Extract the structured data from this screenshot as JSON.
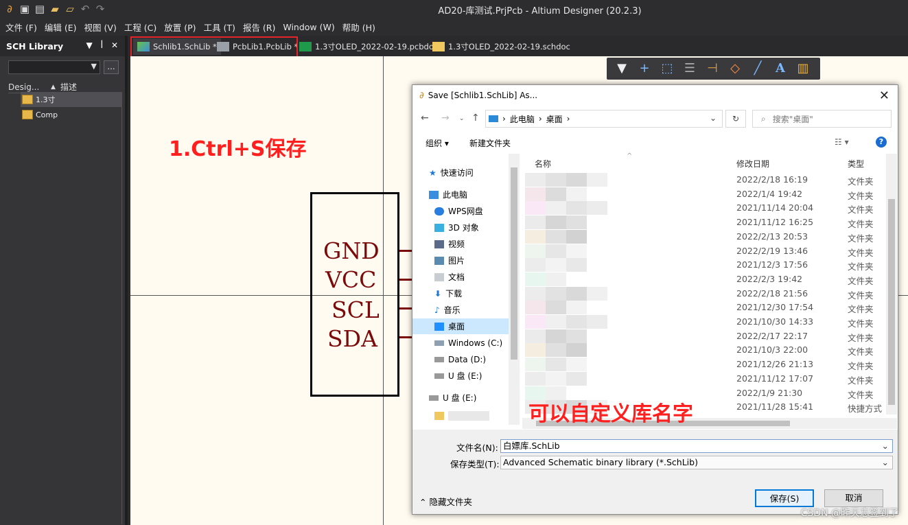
{
  "window": {
    "title": "AD20-库测试.PrjPcb - Altium Designer (20.2.3)"
  },
  "menu": [
    "文件 (F)",
    "编辑 (E)",
    "视图 (V)",
    "工程 (C)",
    "放置 (P)",
    "工具 (T)",
    "报告 (R)",
    "Window (W)",
    "帮助 (H)"
  ],
  "left_panel": {
    "title": "SCH Library",
    "combo_button": "...",
    "col_design": "Desig...",
    "col_desc": "描述",
    "items": [
      "1.3寸",
      "Comp"
    ]
  },
  "tabs": [
    {
      "label": "Schlib1.SchLib *"
    },
    {
      "label": "PcbLib1.PcbLib *"
    },
    {
      "label": "1.3寸OLED_2022-02-19.pcbdoc"
    },
    {
      "label": "1.3寸OLED_2022-02-19.schdoc"
    }
  ],
  "canvas": {
    "pins": [
      "GND",
      "VCC",
      "SCL",
      "SDA"
    ],
    "annotation1": "1.Ctrl+S保存",
    "annotation2": "可以自定义库名字"
  },
  "dialog": {
    "title": "Save [Schlib1.SchLib] As...",
    "path": [
      "此电脑",
      "桌面"
    ],
    "search_placeholder": "搜索\"桌面\"",
    "organize": "组织 ▾",
    "new_folder": "新建文件夹",
    "nav": [
      {
        "label": "快速访问",
        "icon": "star-icon",
        "color": "#1e78d2"
      },
      {
        "label": "此电脑",
        "icon": "computer-icon",
        "color": "#3a8ee0"
      },
      {
        "label": "WPS网盘",
        "icon": "cloud-icon",
        "color": "#2a7de0"
      },
      {
        "label": "3D 对象",
        "icon": "cube-icon",
        "color": "#3ab0e0"
      },
      {
        "label": "视频",
        "icon": "video-icon",
        "color": "#5a6a88"
      },
      {
        "label": "图片",
        "icon": "picture-icon",
        "color": "#5a8ab0"
      },
      {
        "label": "文档",
        "icon": "document-icon",
        "color": "#7a8a99"
      },
      {
        "label": "下载",
        "icon": "download-icon",
        "color": "#1e78d2"
      },
      {
        "label": "音乐",
        "icon": "music-icon",
        "color": "#1e78d2"
      },
      {
        "label": "桌面",
        "icon": "desktop-icon",
        "color": "#1e90ff"
      },
      {
        "label": "Windows (C:)",
        "icon": "drive-icon",
        "color": "#888"
      },
      {
        "label": "Data (D:)",
        "icon": "drive-icon",
        "color": "#888"
      },
      {
        "label": "U 盘 (E:)",
        "icon": "usb-drive-icon",
        "color": "#888"
      },
      {
        "label": "U 盘 (E:)",
        "icon": "usb-drive-icon",
        "color": "#888"
      }
    ],
    "columns": {
      "name": "名称",
      "date": "修改日期",
      "type": "类型"
    },
    "rows": [
      {
        "date": "2022/2/18 16:19",
        "type": "文件夹"
      },
      {
        "date": "2022/1/4 19:42",
        "type": "文件夹"
      },
      {
        "date": "2021/11/14 20:04",
        "type": "文件夹"
      },
      {
        "date": "2021/11/12 16:25",
        "type": "文件夹"
      },
      {
        "date": "2022/2/13 20:53",
        "type": "文件夹"
      },
      {
        "date": "2022/2/19 13:46",
        "type": "文件夹"
      },
      {
        "date": "2021/12/3 17:56",
        "type": "文件夹"
      },
      {
        "date": "2022/2/3 19:42",
        "type": "文件夹"
      },
      {
        "date": "2022/2/18 21:56",
        "type": "文件夹"
      },
      {
        "date": "2021/12/30 17:54",
        "type": "文件夹"
      },
      {
        "date": "2021/10/30 14:33",
        "type": "文件夹"
      },
      {
        "date": "2022/2/17 22:17",
        "type": "文件夹"
      },
      {
        "date": "2021/10/3 22:00",
        "type": "文件夹"
      },
      {
        "date": "2021/12/26 21:13",
        "type": "文件夹"
      },
      {
        "date": "2021/11/12 17:07",
        "type": "文件夹"
      },
      {
        "date": "2022/1/9 21:30",
        "type": "文件夹"
      },
      {
        "date": "2021/11/28 15:41",
        "type": "快捷方式"
      }
    ],
    "filename_label": "文件名(N):",
    "filename_value": "白嫖库.SchLib",
    "filetype_label": "保存类型(T):",
    "filetype_value": "Advanced Schematic binary library (*.SchLib)",
    "hide_folders": "隐藏文件夹",
    "save": "保存(S)",
    "cancel": "取消"
  },
  "watermark": "CSDN @昨天忘签到了"
}
